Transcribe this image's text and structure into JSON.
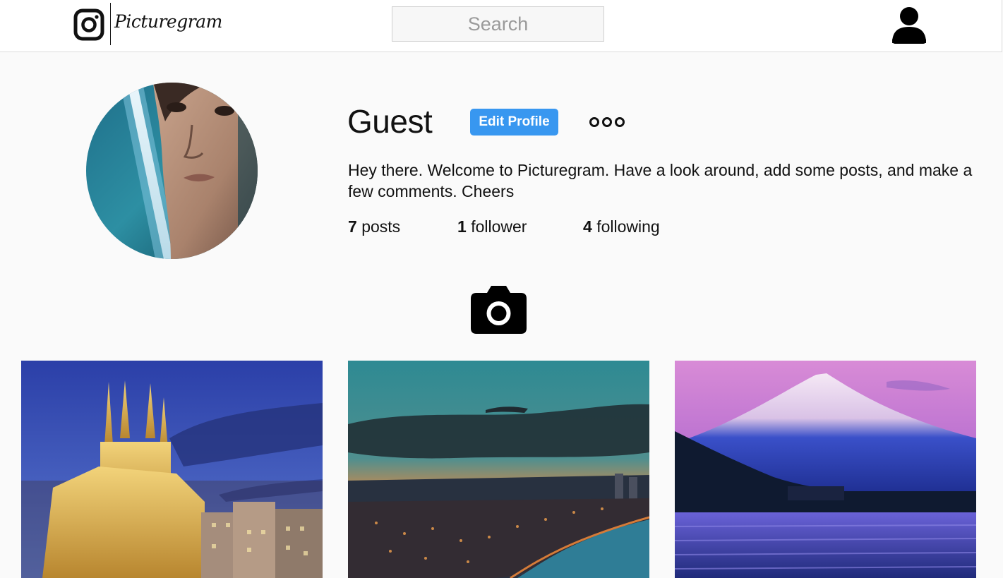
{
  "header": {
    "brand": "Picturegram",
    "search_placeholder": "Search"
  },
  "profile": {
    "username": "Guest",
    "edit_label": "Edit Profile",
    "bio": "Hey there. Welcome to Picturegram. Have a look around, add some posts, and make a few comments. Cheers",
    "stats": {
      "posts_count": "7",
      "posts_label": "posts",
      "followers_count": "1",
      "followers_label": "follower",
      "following_count": "4",
      "following_label": "following"
    }
  },
  "icons": {
    "logo": "camera-logo-icon",
    "user": "user-icon",
    "more": "more-options-icon",
    "upload": "camera-icon"
  },
  "colors": {
    "accent": "#3897f0",
    "background": "#fafafa",
    "header_bg": "#ffffff"
  },
  "posts": [
    {
      "subject": "Sagrada Familia at dusk"
    },
    {
      "subject": "Coastal city at sunset"
    },
    {
      "subject": "Mount Fuji over lake"
    }
  ]
}
